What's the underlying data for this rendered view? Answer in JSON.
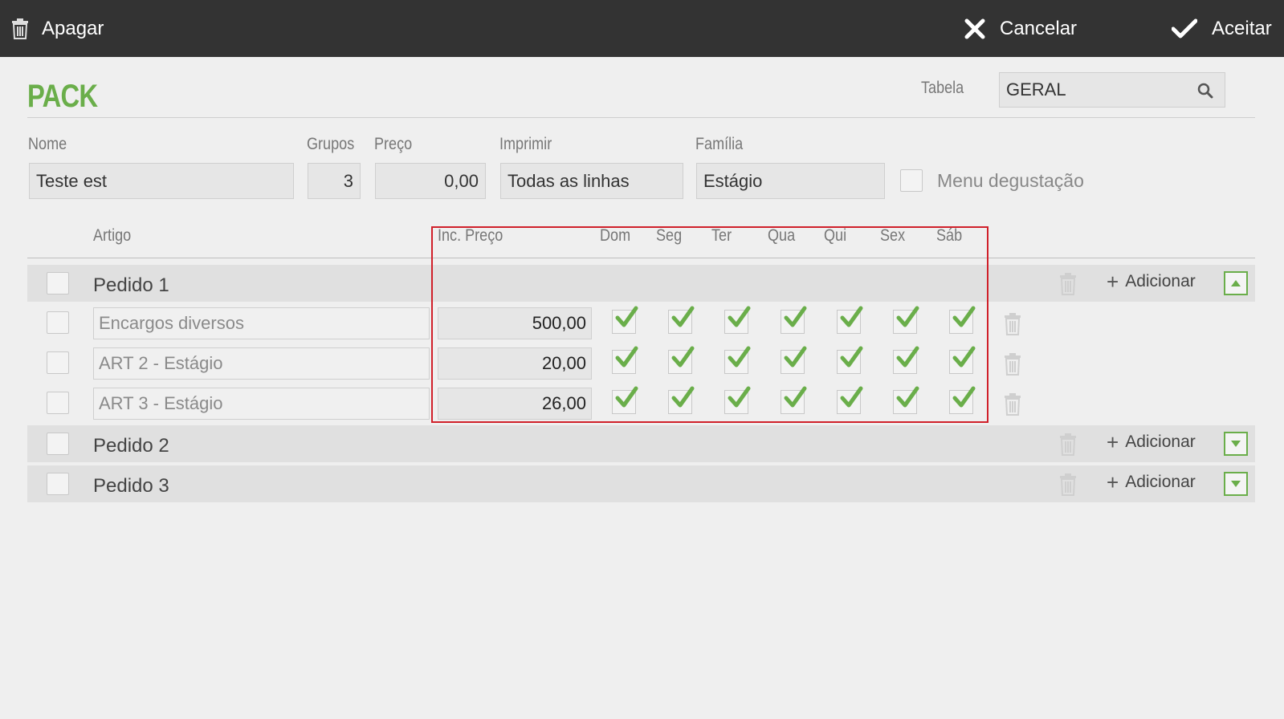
{
  "toolbar": {
    "delete_label": "Apagar",
    "cancel_label": "Cancelar",
    "accept_label": "Aceitar"
  },
  "header": {
    "title": "PACK",
    "table_label": "Tabela",
    "table_value": "GERAL"
  },
  "form": {
    "name_label": "Nome",
    "name_value": "Teste est",
    "groups_label": "Grupos",
    "groups_value": "3",
    "price_label": "Preço",
    "price_value": "0,00",
    "print_label": "Imprimir",
    "print_value": "Todas as linhas",
    "family_label": "Família",
    "family_value": "Estágio",
    "tasting_menu_label": "Menu degustação"
  },
  "columns": {
    "article": "Artigo",
    "inc_price": "Inc. Preço",
    "days": [
      "Dom",
      "Seg",
      "Ter",
      "Qua",
      "Qui",
      "Sex",
      "Sáb"
    ]
  },
  "groups": [
    {
      "name": "Pedido 1",
      "add_label": "Adicionar",
      "expanded": true,
      "items": [
        {
          "name": "Encargos diversos",
          "price": "500,00",
          "days": [
            true,
            true,
            true,
            true,
            true,
            true,
            true
          ]
        },
        {
          "name": "ART 2 - Estágio",
          "price": "20,00",
          "days": [
            true,
            true,
            true,
            true,
            true,
            true,
            true
          ]
        },
        {
          "name": "ART 3 - Estágio",
          "price": "26,00",
          "days": [
            true,
            true,
            true,
            true,
            true,
            true,
            true
          ]
        }
      ]
    },
    {
      "name": "Pedido 2",
      "add_label": "Adicionar",
      "expanded": false
    },
    {
      "name": "Pedido 3",
      "add_label": "Adicionar",
      "expanded": false
    }
  ],
  "colors": {
    "topbar": "#333333",
    "accent_green": "#6aae4a",
    "highlight_red": "#d0202a",
    "background": "#efefef"
  },
  "icons": {
    "delete": "trash-icon",
    "cancel": "close-icon",
    "accept": "checkmark-icon",
    "search": "search-icon",
    "collapse": "triangle-up-icon",
    "expand": "triangle-down-icon"
  }
}
